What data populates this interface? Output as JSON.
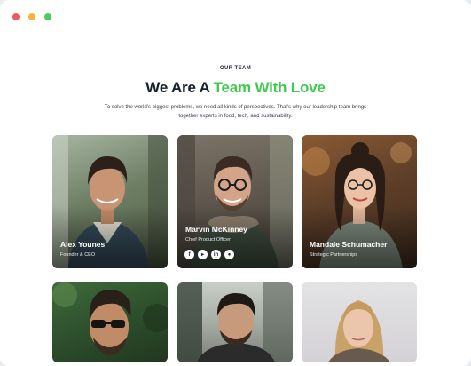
{
  "window": {
    "controls": [
      "close",
      "minimize",
      "maximize"
    ]
  },
  "section": {
    "eyebrow": "OUR TEAM",
    "heading_prefix": "We Are A ",
    "heading_accent": "Team With Love",
    "subtitle": "To solve the world's biggest problems, we need all kinds of perspectives. That's why our leadership team brings together experts in food, tech, and sustainability."
  },
  "colors": {
    "accent": "#3fca4f",
    "heading": "#13202e"
  },
  "team": [
    {
      "name": "Alex Younes",
      "role": "Founder & CEO"
    },
    {
      "name": "Marvin McKinney",
      "role": "Chief Product Officer",
      "socials": [
        "facebook-icon",
        "youtube-icon",
        "linkedin-icon",
        "github-icon"
      ]
    },
    {
      "name": "Mandale Schumacher",
      "role": "Strategic Partnerships"
    },
    {
      "name": "",
      "role": ""
    },
    {
      "name": "",
      "role": ""
    },
    {
      "name": "",
      "role": ""
    }
  ]
}
